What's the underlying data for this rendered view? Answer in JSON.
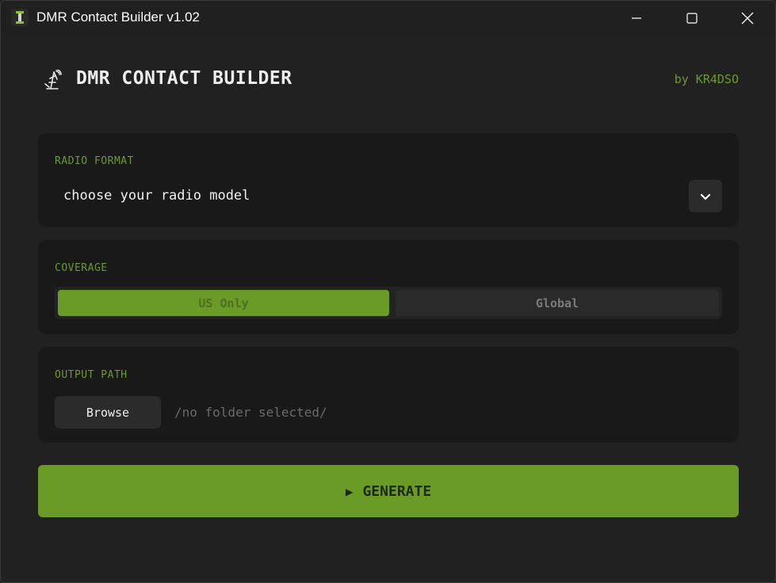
{
  "window": {
    "title": "DMR Contact Builder v1.02"
  },
  "header": {
    "icon": "radio-tower-icon",
    "title": "DMR CONTACT BUILDER",
    "author": "by KR4DSO"
  },
  "radio_format": {
    "label": "RADIO FORMAT",
    "selected_value": "choose your radio model"
  },
  "coverage": {
    "label": "COVERAGE",
    "options": [
      "US Only",
      "Global"
    ],
    "selected": "US Only"
  },
  "output_path": {
    "label": "OUTPUT PATH",
    "browse_label": "Browse",
    "path": "/no folder selected/"
  },
  "generate": {
    "label": "GENERATE",
    "icon": "play-icon"
  },
  "colors": {
    "accent": "#6a9b26",
    "label_green": "#6a9a2a",
    "background": "#212121",
    "card": "#191919"
  }
}
